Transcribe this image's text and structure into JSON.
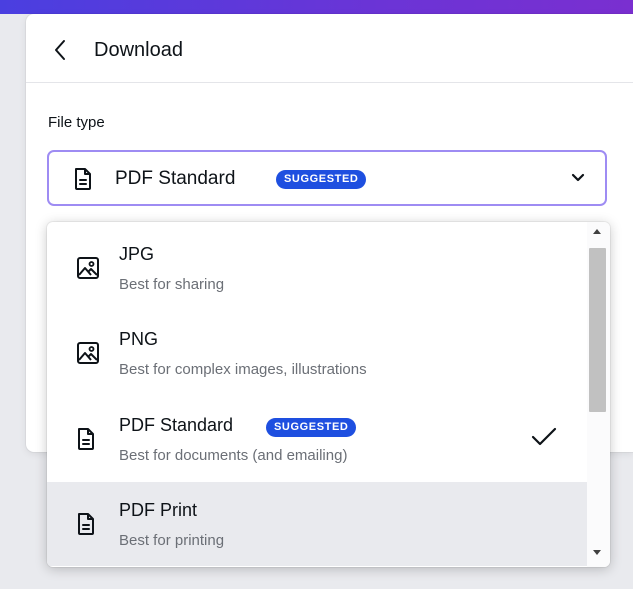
{
  "header": {
    "title": "Download"
  },
  "file_type": {
    "label": "File type",
    "selected_value": "PDF Standard",
    "selected_badge": "SUGGESTED"
  },
  "options": [
    {
      "title": "JPG",
      "description": "Best for sharing",
      "icon": "image-icon"
    },
    {
      "title": "PNG",
      "description": "Best for complex images, illustrations",
      "icon": "image-icon"
    },
    {
      "title": "PDF Standard",
      "description": "Best for documents (and emailing)",
      "icon": "document-icon",
      "badge": "SUGGESTED",
      "selected": true
    },
    {
      "title": "PDF Print",
      "description": "Best for printing",
      "icon": "document-icon",
      "hovered": true
    }
  ],
  "colors": {
    "accent_gradient_start": "#4a3fe0",
    "accent_gradient_end": "#7a2fd0",
    "badge_blue": "#1e4fe0",
    "select_border": "#9e8cf3",
    "hover_bg": "#e9eaee"
  }
}
